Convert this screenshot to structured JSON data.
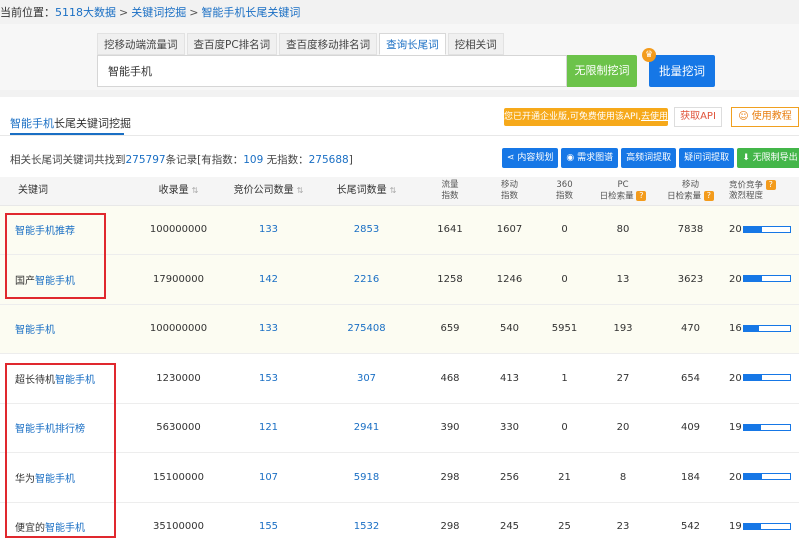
{
  "breadcrumb": {
    "prefix": "当前位置：",
    "items": [
      "5118大数据",
      "关键词挖掘",
      "智能手机长尾关键词"
    ],
    "separator": ">"
  },
  "tabs": [
    "挖移动端流量词",
    "查百度PC排名词",
    "查百度移动排名词",
    "查询长尾词",
    "挖相关词"
  ],
  "active_tab": "查询长尾词",
  "search": {
    "value": "智能手机",
    "unlimited_label": "无限制挖词",
    "batch_label": "批量挖词"
  },
  "panel": {
    "title_keyword": "智能手机",
    "title_rest": "长尾关键词挖掘",
    "promo": "您已开通企业版,可免费使用该API,",
    "promo_link": "去使用",
    "api_label": "获取API",
    "tutorial_label": "使用教程"
  },
  "summary": {
    "prefix": "相关长尾词关键词共找到",
    "total": "275797",
    "mid": "条记录[有指数：",
    "with_index": "109",
    "mid2": " 无指数：",
    "without_index": "275688",
    "suffix": "]"
  },
  "actions": [
    "内容规划",
    "需求图谱",
    "高频词提取",
    "疑问词提取",
    "无限制导出"
  ],
  "columns": {
    "keyword": "关键词",
    "indexed": "收录量",
    "bidders": "竞价公司数量",
    "longtail": "长尾词数量",
    "flow_index": [
      "流量",
      "指数"
    ],
    "mobile_index": [
      "移动",
      "指数"
    ],
    "so360_index": [
      "360",
      "指数"
    ],
    "pc_daily": [
      "PC",
      "日检索量"
    ],
    "mobile_daily": [
      "移动",
      "日检索量"
    ],
    "competition": [
      "竞价竞争",
      "激烈程度"
    ]
  },
  "rows": [
    {
      "kw_pre": "",
      "kw_hl": "智能手机",
      "kw_post": "推荐",
      "indexed": "100000000",
      "bidders": "133",
      "longtail": "2853",
      "flow": "1641",
      "mobile": "1607",
      "s360": "0",
      "pc": "80",
      "mob_daily": "7838",
      "comp": 20,
      "comp_level": 0.4
    },
    {
      "kw_pre": "国产",
      "kw_hl": "智能手机",
      "kw_post": "",
      "indexed": "17900000",
      "bidders": "142",
      "longtail": "2216",
      "flow": "1258",
      "mobile": "1246",
      "s360": "0",
      "pc": "13",
      "mob_daily": "3623",
      "comp": 20,
      "comp_level": 0.4
    },
    {
      "kw_pre": "",
      "kw_hl": "智能手机",
      "kw_post": "",
      "indexed": "100000000",
      "bidders": "133",
      "longtail": "275408",
      "flow": "659",
      "mobile": "540",
      "s360": "5951",
      "pc": "193",
      "mob_daily": "470",
      "comp": 16,
      "comp_level": 0.32
    },
    {
      "kw_pre": "超长待机",
      "kw_hl": "智能手机",
      "kw_post": "",
      "indexed": "1230000",
      "bidders": "153",
      "longtail": "307",
      "flow": "468",
      "mobile": "413",
      "s360": "1",
      "pc": "27",
      "mob_daily": "654",
      "comp": 20,
      "comp_level": 0.4
    },
    {
      "kw_pre": "",
      "kw_hl": "智能手机",
      "kw_post": "排行榜",
      "indexed": "5630000",
      "bidders": "121",
      "longtail": "2941",
      "flow": "390",
      "mobile": "330",
      "s360": "0",
      "pc": "20",
      "mob_daily": "409",
      "comp": 19,
      "comp_level": 0.38
    },
    {
      "kw_pre": "华为",
      "kw_hl": "智能手机",
      "kw_post": "",
      "indexed": "15100000",
      "bidders": "107",
      "longtail": "5918",
      "flow": "298",
      "mobile": "256",
      "s360": "21",
      "pc": "8",
      "mob_daily": "184",
      "comp": 20,
      "comp_level": 0.4
    },
    {
      "kw_pre": "便宜的",
      "kw_hl": "智能手机",
      "kw_post": "",
      "indexed": "35100000",
      "bidders": "155",
      "longtail": "1532",
      "flow": "298",
      "mobile": "245",
      "s360": "25",
      "pc": "23",
      "mob_daily": "542",
      "comp": 19,
      "comp_level": 0.38
    }
  ]
}
